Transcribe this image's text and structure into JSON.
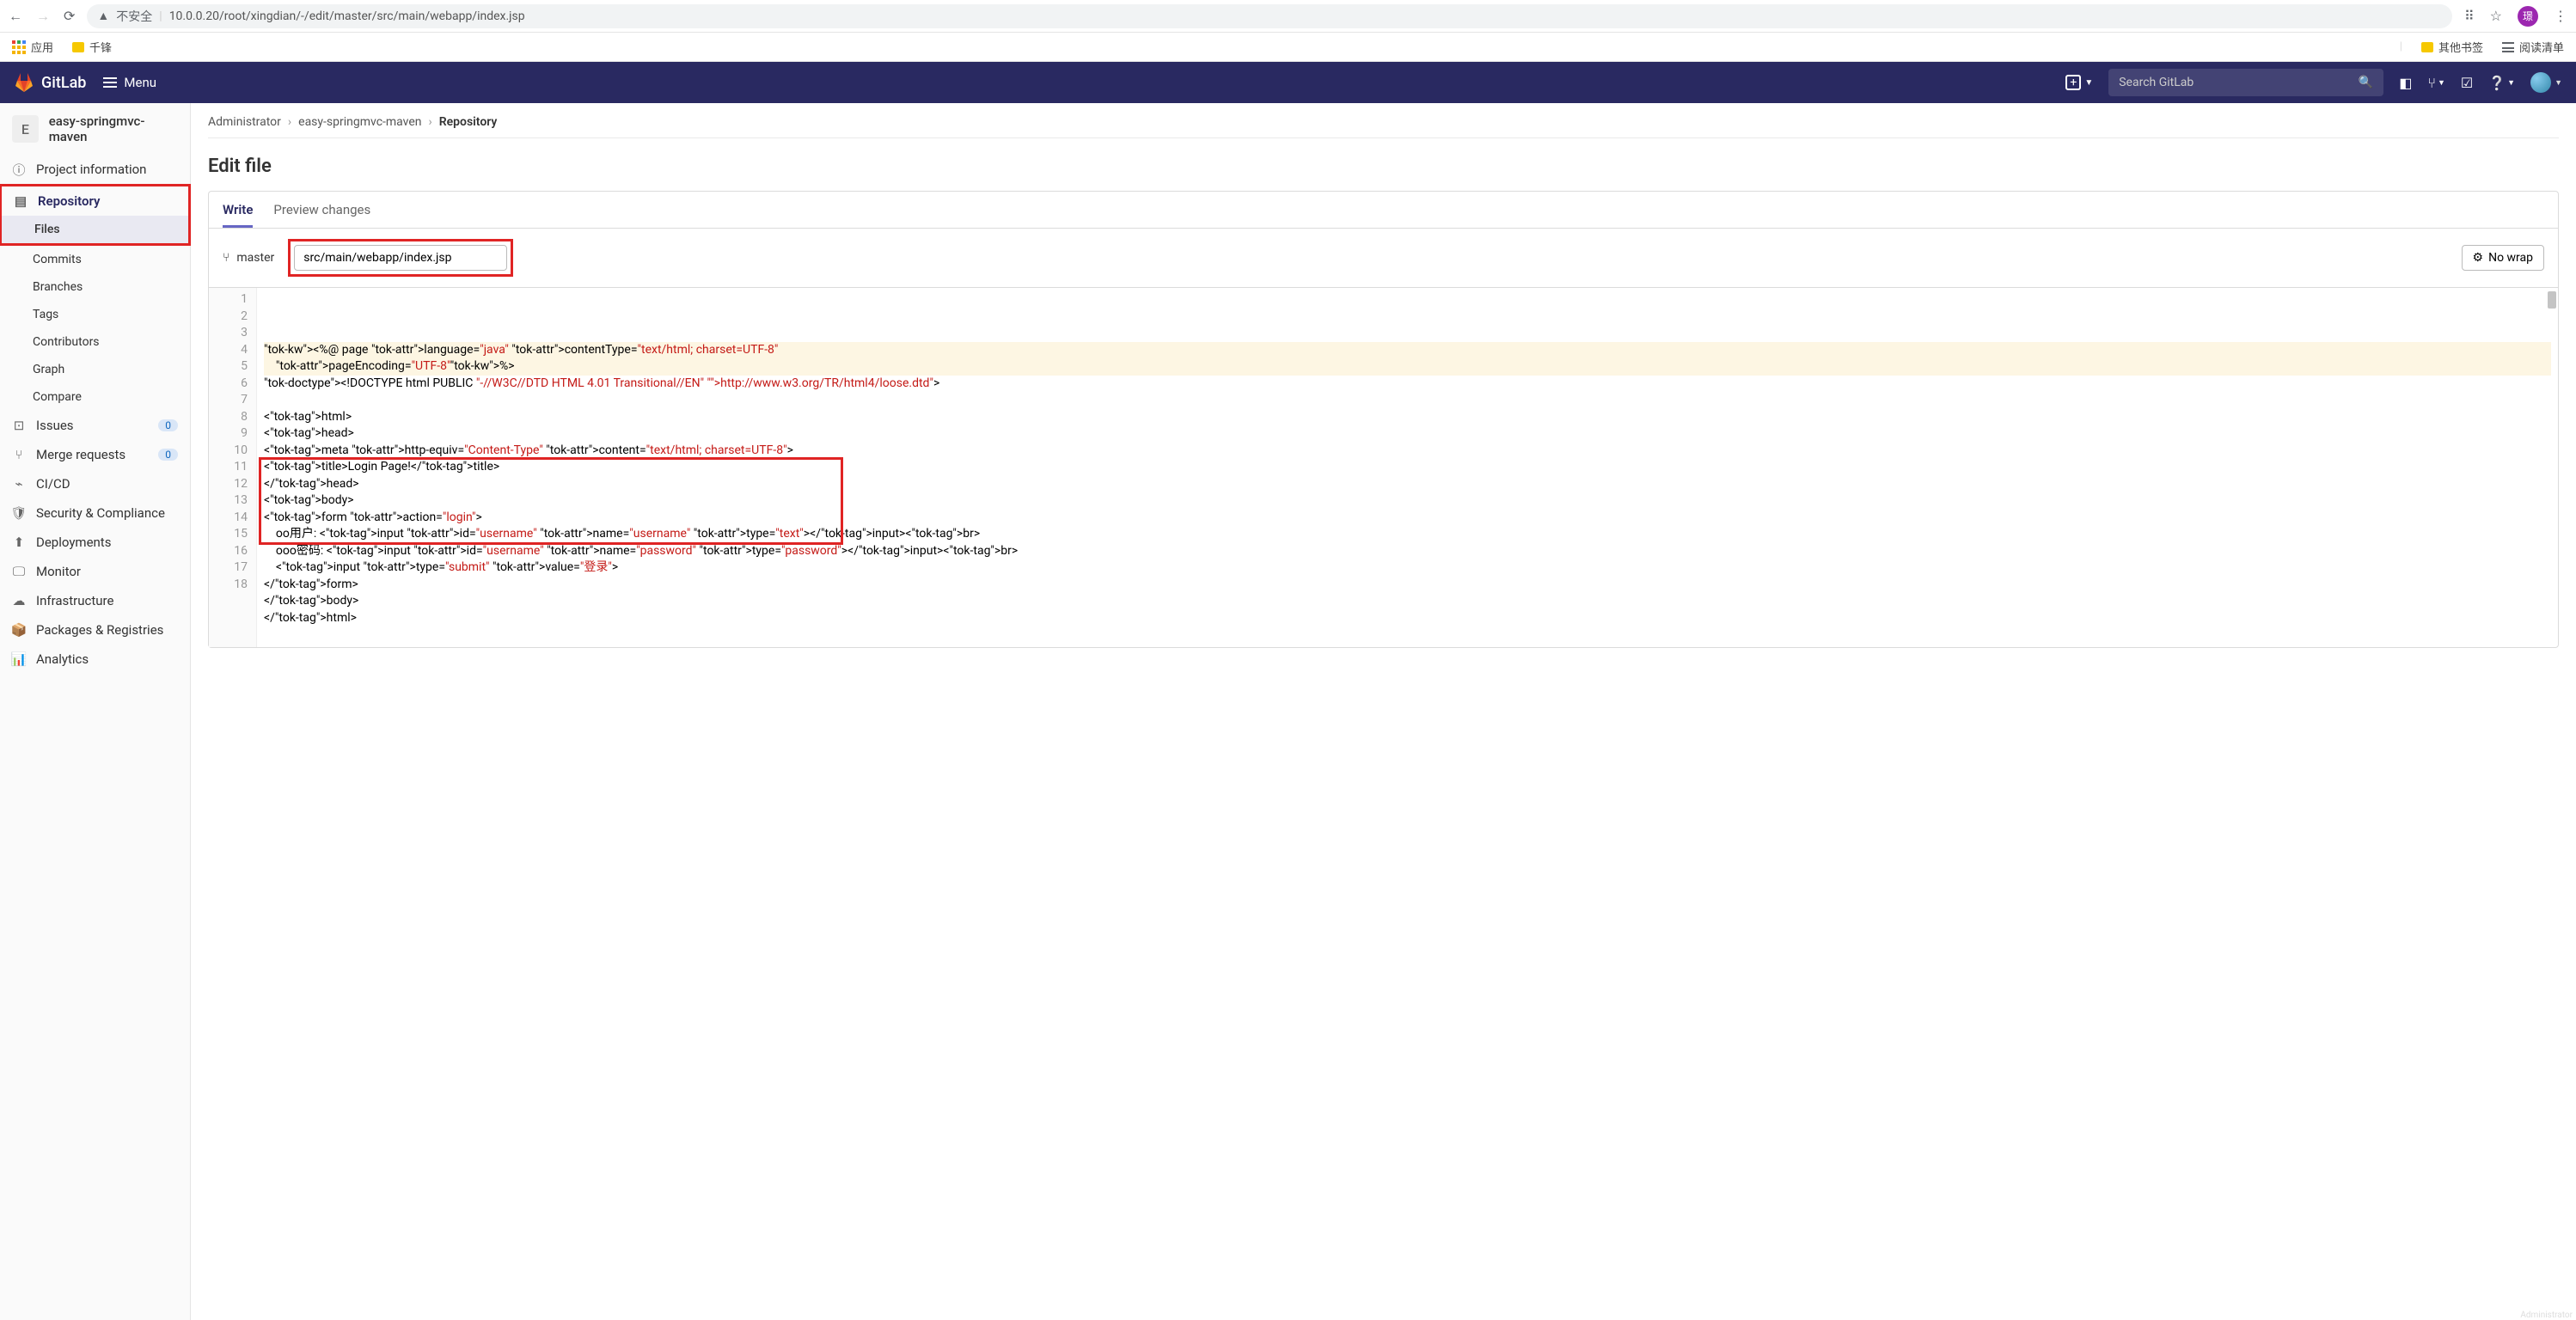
{
  "browser": {
    "url_prefix": "不安全",
    "url": "10.0.0.20/root/xingdian/-/edit/master/src/main/webapp/index.jsp",
    "avatar_letter": "璟"
  },
  "bookmarks": {
    "apps": "应用",
    "qf": "千锋",
    "other": "其他书签",
    "reading": "阅读清单"
  },
  "topbar": {
    "brand": "GitLab",
    "menu": "Menu",
    "search_placeholder": "Search GitLab",
    "admin_label": "Administrator"
  },
  "sidebar": {
    "project_letter": "E",
    "project_name": "easy-springmvc-maven",
    "items": [
      {
        "icon": "info",
        "label": "Project information"
      },
      {
        "icon": "repo",
        "label": "Repository",
        "active_parent": true
      },
      {
        "sub": true,
        "label": "Files",
        "active_sub": true
      },
      {
        "sub": true,
        "label": "Commits"
      },
      {
        "sub": true,
        "label": "Branches"
      },
      {
        "sub": true,
        "label": "Tags"
      },
      {
        "sub": true,
        "label": "Contributors"
      },
      {
        "sub": true,
        "label": "Graph"
      },
      {
        "sub": true,
        "label": "Compare"
      },
      {
        "icon": "issues",
        "label": "Issues",
        "badge": "0"
      },
      {
        "icon": "mr",
        "label": "Merge requests",
        "badge": "0"
      },
      {
        "icon": "cicd",
        "label": "CI/CD"
      },
      {
        "icon": "shield",
        "label": "Security & Compliance"
      },
      {
        "icon": "deploy",
        "label": "Deployments"
      },
      {
        "icon": "monitor",
        "label": "Monitor"
      },
      {
        "icon": "infra",
        "label": "Infrastructure"
      },
      {
        "icon": "pkg",
        "label": "Packages & Registries"
      },
      {
        "icon": "analytics",
        "label": "Analytics"
      }
    ]
  },
  "breadcrumb": {
    "a": "Administrator",
    "b": "easy-springmvc-maven",
    "c": "Repository"
  },
  "page": {
    "title": "Edit file",
    "tab_write": "Write",
    "tab_preview": "Preview changes",
    "branch": "master",
    "path": "src/main/webapp/index.jsp",
    "nowrap": "No wrap"
  },
  "code": {
    "lines": [
      "<%@ page language=\"java\" contentType=\"text/html; charset=UTF-8\"",
      "    pageEncoding=\"UTF-8\"%>",
      "<!DOCTYPE html PUBLIC \"-//W3C//DTD HTML 4.01 Transitional//EN\" \"http://www.w3.org/TR/html4/loose.dtd\">",
      "",
      "<html>",
      "<head>",
      "<meta http-equiv=\"Content-Type\" content=\"text/html; charset=UTF-8\">",
      "<title>Login Page!</title>",
      "</head>",
      "<body>",
      "<form action=\"login\">",
      "    oo用户: <input id=\"username\" name=\"username\" type=\"text\"></input><br>",
      "    ooo密码: <input id=\"username\" name=\"password\" type=\"password\"></input><br>",
      "    <input type=\"submit\" value=\"登录\">",
      "</form>",
      "</body>",
      "</html>",
      ""
    ]
  }
}
